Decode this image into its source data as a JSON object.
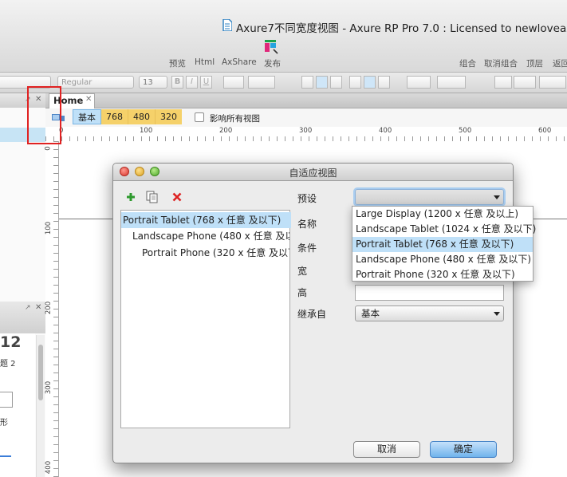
{
  "window": {
    "title": "Axure7不同宽度视图 - Axure RP Pro 7.0 : Licensed to newloveaxur"
  },
  "toolbar": {
    "left": [
      "预览",
      "Html",
      "AxShare",
      "发布"
    ],
    "right": [
      "组合",
      "取消组合",
      "顶层",
      "返回"
    ]
  },
  "formatbar": {
    "font_style": "Regular",
    "font_size": "13",
    "bold": "B",
    "italic": "I",
    "underline": "U"
  },
  "tabs": [
    {
      "label": "Home"
    }
  ],
  "viewbar": {
    "base": "基本",
    "views": [
      "768",
      "480",
      "320"
    ],
    "affect_all_label": "影响所有视图"
  },
  "ruler": {
    "h": [
      "0",
      "100",
      "200",
      "300",
      "400",
      "500",
      "600"
    ],
    "v": [
      "0",
      "100",
      "200",
      "300",
      "400"
    ]
  },
  "left_panel": {
    "number": "12",
    "text1": "题 2",
    "text2": "形"
  },
  "dialog": {
    "title": "自适应视图",
    "views": [
      "Portrait Tablet (768 x 任意 及以下)",
      "Landscape Phone (480 x 任意 及以下)",
      "Portrait Phone (320 x 任意 及以下)"
    ],
    "labels": {
      "preset": "预设",
      "name": "名称",
      "condition": "条件",
      "width": "宽",
      "height": "高",
      "inherit": "继承自"
    },
    "inherit_value": "基本",
    "preset_options": [
      "Large Display (1200 x 任意 及以上)",
      "Landscape Tablet (1024 x 任意 及以下)",
      "Portrait Tablet (768 x 任意 及以下)",
      "Landscape Phone (480 x 任意 及以下)",
      "Portrait Phone (320 x 任意 及以下)"
    ],
    "cancel": "取消",
    "ok": "确定"
  },
  "colors": {
    "accent": "#6fb3ec",
    "highlight_outline": "#e02222",
    "view_tab_yellow": "#f5d16a",
    "selection": "#bfe0f8"
  }
}
